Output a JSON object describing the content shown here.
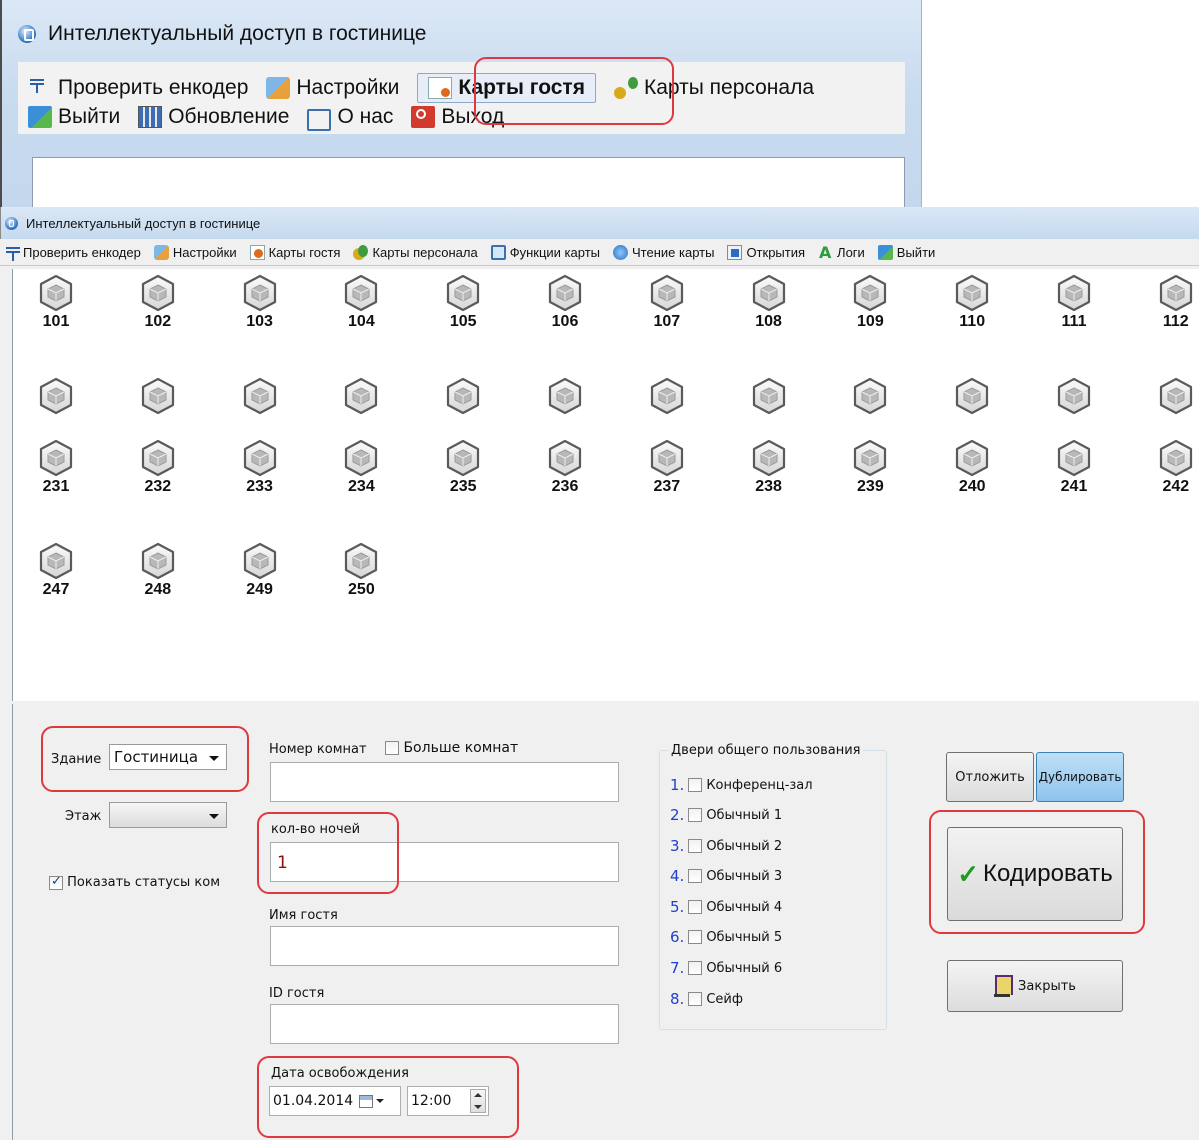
{
  "snippet": {
    "title": "Интеллектуальный доступ в гостинице",
    "toolbar_row1": [
      {
        "label": "Проверить енкодер",
        "icon": "encoder-icon"
      },
      {
        "label": "Настройки",
        "icon": "settings-icon"
      },
      {
        "label": "Карты гостя",
        "icon": "guest-card-icon"
      },
      {
        "label": "Карты персонала",
        "icon": "staff-card-icon"
      }
    ],
    "toolbar_row2": [
      {
        "label": "Выйти",
        "icon": "exit-icon"
      },
      {
        "label": "Обновление",
        "icon": "update-icon"
      },
      {
        "label": "О нас",
        "icon": "about-icon"
      },
      {
        "label": "Выход",
        "icon": "quit-icon"
      }
    ]
  },
  "window": {
    "title": "Интеллектуальный доступ в гостинице",
    "toolbar": [
      {
        "label": "Проверить енкодер",
        "icon": "encoder-icon"
      },
      {
        "label": "Настройки",
        "icon": "settings-icon"
      },
      {
        "label": "Карты гостя",
        "icon": "guest-card-icon"
      },
      {
        "label": "Карты персонала",
        "icon": "staff-card-icon"
      },
      {
        "label": "Функции карты",
        "icon": "card-functions-icon"
      },
      {
        "label": "Чтение карты",
        "icon": "read-card-icon"
      },
      {
        "label": "Открытия",
        "icon": "openings-icon"
      },
      {
        "label": "Логи",
        "icon": "logs-icon"
      },
      {
        "label": "Выйти",
        "icon": "exit-icon"
      }
    ]
  },
  "rooms": {
    "row1": [
      "101",
      "102",
      "103",
      "104",
      "105",
      "106",
      "107",
      "108",
      "109",
      "110",
      "111",
      "112"
    ],
    "row2": [
      "",
      "",
      "",
      "",
      "",
      "",
      "",
      "",
      "",
      "",
      "",
      ""
    ],
    "row3": [
      "231",
      "232",
      "233",
      "234",
      "235",
      "236",
      "237",
      "238",
      "239",
      "240",
      "241",
      "242"
    ],
    "row4": [
      "247",
      "248",
      "249",
      "250"
    ]
  },
  "form": {
    "building_label": "Здание",
    "building_value": "Гостиница",
    "floor_label": "Этаж",
    "floor_value": "",
    "show_status_label": "Показать статусы ком",
    "show_status_checked": true,
    "room_number_label": "Номер комнат",
    "more_rooms_label": "Больше комнат",
    "room_number_value": "",
    "nights_label": "кол-во ночей",
    "nights_value": "1",
    "guest_name_label": "Имя гостя",
    "guest_name_value": "",
    "guest_id_label": "ID гостя",
    "guest_id_value": "",
    "checkout_label": "Дата освобождения",
    "checkout_date": "01.04.2014",
    "checkout_time": "12:00"
  },
  "doors": {
    "title": "Двери общего пользования",
    "items": [
      {
        "n": "1.",
        "label": "Конференц-зал"
      },
      {
        "n": "2.",
        "label": "Обычный 1"
      },
      {
        "n": "3.",
        "label": "Обычный 2"
      },
      {
        "n": "4.",
        "label": "Обычный 3"
      },
      {
        "n": "5.",
        "label": "Обычный 4"
      },
      {
        "n": "6.",
        "label": "Обычный 5"
      },
      {
        "n": "7.",
        "label": "Обычный 6"
      },
      {
        "n": "8.",
        "label": "Сейф"
      }
    ]
  },
  "buttons": {
    "postpone": "Отложить",
    "duplicate": "Дублировать",
    "encode": "Кодировать",
    "close": "Закрыть"
  },
  "colors": {
    "highlight": "#e0383f",
    "door_number": "#1f3fd0",
    "nights_value": "#8a1010",
    "encode_check": "#1f9a1f"
  }
}
